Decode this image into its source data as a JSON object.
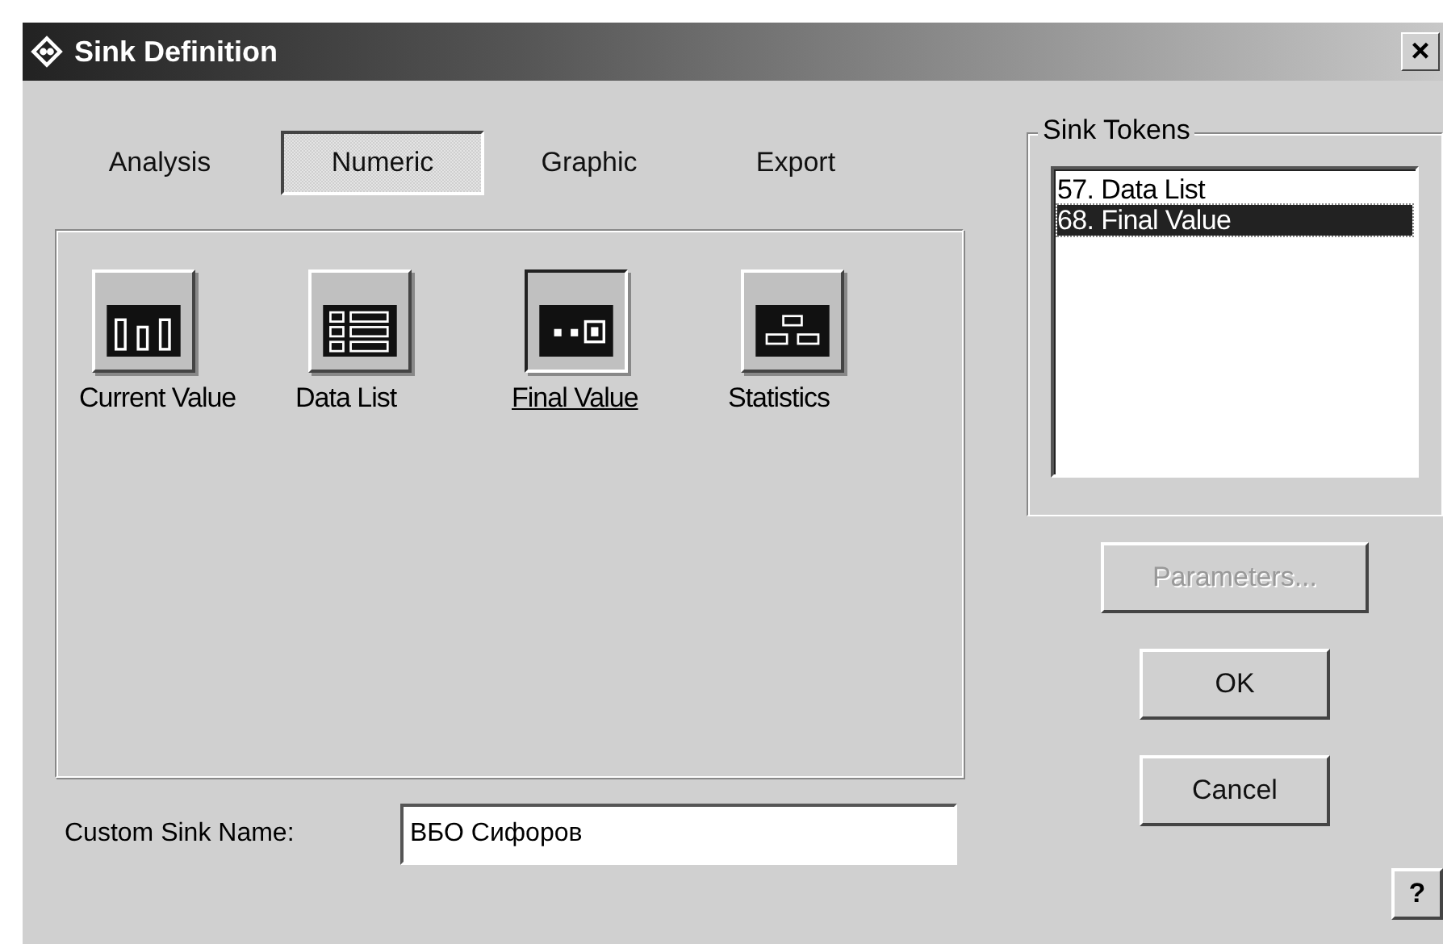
{
  "window": {
    "title": "Sink Definition",
    "close": "×"
  },
  "tabs": [
    {
      "label": "Analysis",
      "selected": false
    },
    {
      "label": "Numeric",
      "selected": true
    },
    {
      "label": "Graphic",
      "selected": false
    },
    {
      "label": "Export",
      "selected": false
    }
  ],
  "sinks": [
    {
      "label": "Current Value",
      "kind": "bars",
      "selected": false
    },
    {
      "label": "Data List",
      "kind": "list",
      "selected": false
    },
    {
      "label": "Final Value",
      "kind": "final",
      "selected": true
    },
    {
      "label": "Statistics",
      "kind": "tree",
      "selected": false
    }
  ],
  "sink_tokens": {
    "title": "Sink Tokens",
    "items": [
      {
        "label": "57. Data List",
        "selected": false
      },
      {
        "label": "68. Final Value",
        "selected": true
      }
    ]
  },
  "buttons": [
    {
      "label": "Parameters...",
      "disabled": true
    },
    {
      "label": "OK",
      "disabled": false
    },
    {
      "label": "Cancel",
      "disabled": false
    }
  ],
  "custom_name": {
    "label": "Custom Sink Name:",
    "value": "ВБО Сифоров"
  },
  "help": "?"
}
